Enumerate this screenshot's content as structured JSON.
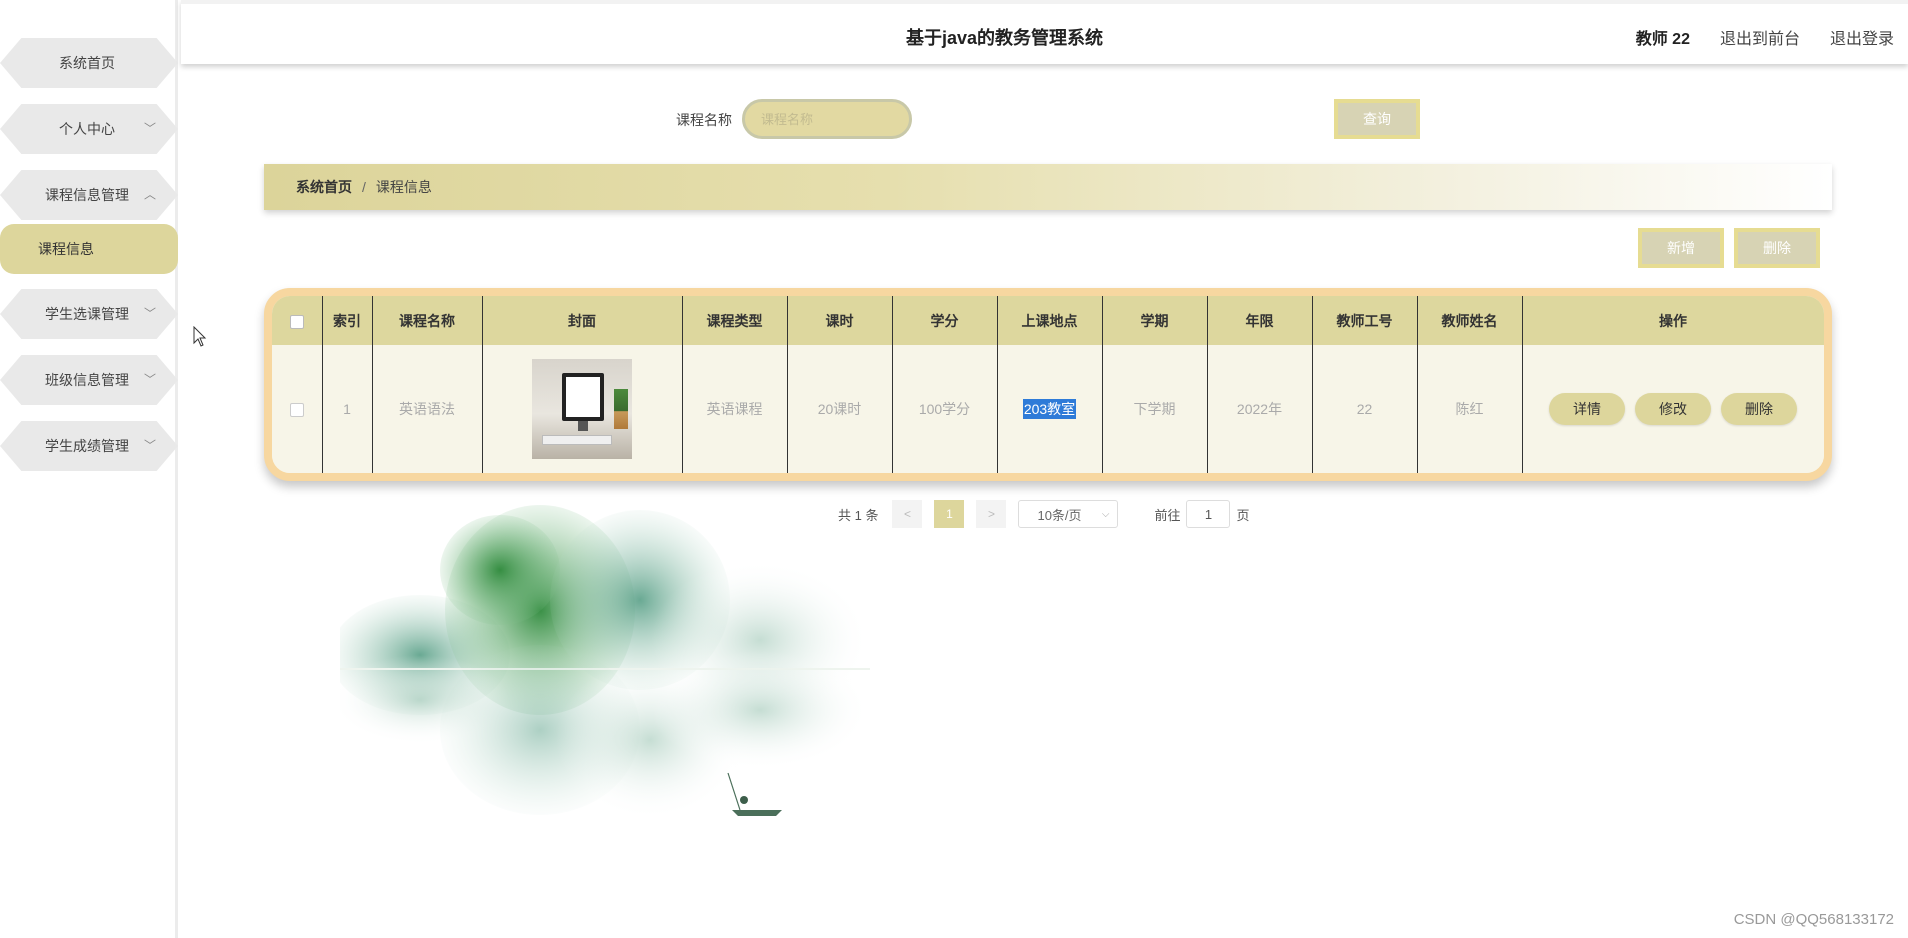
{
  "sidebar": {
    "items": [
      {
        "label": "系统首页",
        "chevron": ""
      },
      {
        "label": "个人中心",
        "chevron": "﹀"
      },
      {
        "label": "课程信息管理",
        "chevron": "︿"
      },
      {
        "label": "学生选课管理",
        "chevron": "﹀"
      },
      {
        "label": "班级信息管理",
        "chevron": "﹀"
      },
      {
        "label": "学生成绩管理",
        "chevron": "﹀"
      }
    ],
    "active_sub": "课程信息"
  },
  "header": {
    "title": "基于java的教务管理系统",
    "user": "教师 22",
    "to_front": "退出到前台",
    "logout": "退出登录"
  },
  "search": {
    "label": "课程名称",
    "placeholder": "课程名称",
    "button": "查询"
  },
  "breadcrumb": {
    "home": "系统首页",
    "separator": "/",
    "current": "课程信息"
  },
  "actions": {
    "add": "新增",
    "delete": "删除"
  },
  "table": {
    "headers": [
      "索引",
      "课程名称",
      "封面",
      "课程类型",
      "课时",
      "学分",
      "上课地点",
      "学期",
      "年限",
      "教师工号",
      "教师姓名",
      "操作"
    ],
    "rows": [
      {
        "index": "1",
        "course_name": "英语语法",
        "course_type": "英语课程",
        "hours": "20课时",
        "credits": "100学分",
        "location": "203教室",
        "term": "下学期",
        "year": "2022年",
        "teacher_id": "22",
        "teacher_name": "陈红",
        "ops": {
          "detail": "详情",
          "edit": "修改",
          "delete": "删除"
        }
      }
    ]
  },
  "pagination": {
    "total": "共 1 条",
    "prev": "<",
    "current": "1",
    "next": ">",
    "page_size": "10条/页",
    "goto_prefix": "前往",
    "goto_value": "1",
    "goto_suffix": "页"
  },
  "watermark": "CSDN @QQ568133172",
  "colors": {
    "accent": "#ddd69c",
    "table_border": "#f7d7a0",
    "highlight": "#2e7bd8"
  }
}
